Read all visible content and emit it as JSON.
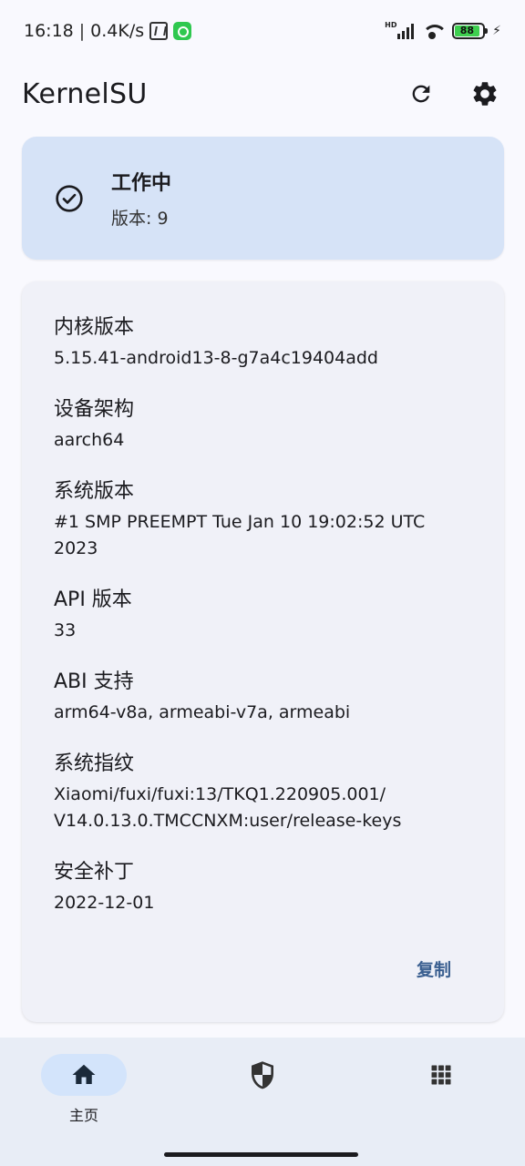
{
  "status_bar": {
    "time": "16:18",
    "separator": "|",
    "network_speed": "0.4K/s",
    "signal_label": "HD",
    "battery": "88"
  },
  "app_bar": {
    "title": "KernelSU",
    "icons": [
      "refresh-icon",
      "gear-icon"
    ]
  },
  "status_card": {
    "title": "工作中",
    "version": "版本: 9",
    "icon": "check-circle-icon",
    "background": "#d6e3f7"
  },
  "info": {
    "items": [
      {
        "label": "内核版本",
        "value": "5.15.41-android13-8-g7a4c19404add"
      },
      {
        "label": "设备架构",
        "value": "aarch64"
      },
      {
        "label": "系统版本",
        "value": "#1 SMP PREEMPT Tue Jan 10 19:02:52 UTC 2023"
      },
      {
        "label": "API 版本",
        "value": "33"
      },
      {
        "label": "ABI 支持",
        "value": "arm64-v8a, armeabi-v7a, armeabi"
      },
      {
        "label": "系统指纹",
        "value": "Xiaomi/fuxi/fuxi:13/TKQ1.220905.001/ V14.0.13.0.TMCCNXM:user/release-keys"
      },
      {
        "label": "安全补丁",
        "value": "2022-12-01"
      }
    ],
    "copy_label": "复制",
    "accent": "#3a5f90"
  },
  "bottom_nav": {
    "items": [
      {
        "label": "主页",
        "icon": "home-icon",
        "active": true
      },
      {
        "label": "",
        "icon": "shield-icon",
        "active": false
      },
      {
        "label": "",
        "icon": "apps-grid-icon",
        "active": false
      }
    ]
  }
}
